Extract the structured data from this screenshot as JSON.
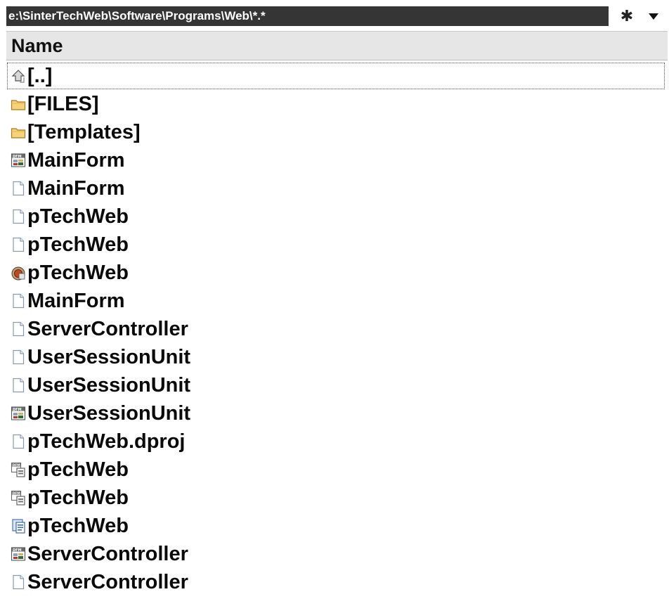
{
  "path_bar": {
    "path": "e:\\SinterTechWeb\\Software\\Programs\\Web\\*.*",
    "filter_glyph": "✱"
  },
  "header": {
    "name_label": "Name"
  },
  "rows": [
    {
      "label": "[..]",
      "icon": "up-arrow-icon"
    },
    {
      "label": "[FILES]",
      "icon": "folder-icon"
    },
    {
      "label": "[Templates]",
      "icon": "folder-icon"
    },
    {
      "label": "MainForm",
      "icon": "dfm-form-icon"
    },
    {
      "label": "MainForm",
      "icon": "document-icon"
    },
    {
      "label": "pTechWeb",
      "icon": "document-icon"
    },
    {
      "label": "pTechWeb",
      "icon": "document-icon"
    },
    {
      "label": "pTechWeb",
      "icon": "project-resource-icon"
    },
    {
      "label": "MainForm",
      "icon": "document-icon"
    },
    {
      "label": "ServerController",
      "icon": "document-icon"
    },
    {
      "label": "UserSessionUnit",
      "icon": "document-icon"
    },
    {
      "label": "UserSessionUnit",
      "icon": "document-icon"
    },
    {
      "label": "UserSessionUnit",
      "icon": "dfm-form-icon"
    },
    {
      "label": "pTechWeb.dproj",
      "icon": "document-icon"
    },
    {
      "label": "pTechWeb",
      "icon": "dfm-copy-icon"
    },
    {
      "label": "pTechWeb",
      "icon": "dfm-copy-icon"
    },
    {
      "label": "pTechWeb",
      "icon": "blue-document-icon"
    },
    {
      "label": "ServerController",
      "icon": "dfm-form-icon"
    },
    {
      "label": "ServerController",
      "icon": "document-icon"
    }
  ]
}
